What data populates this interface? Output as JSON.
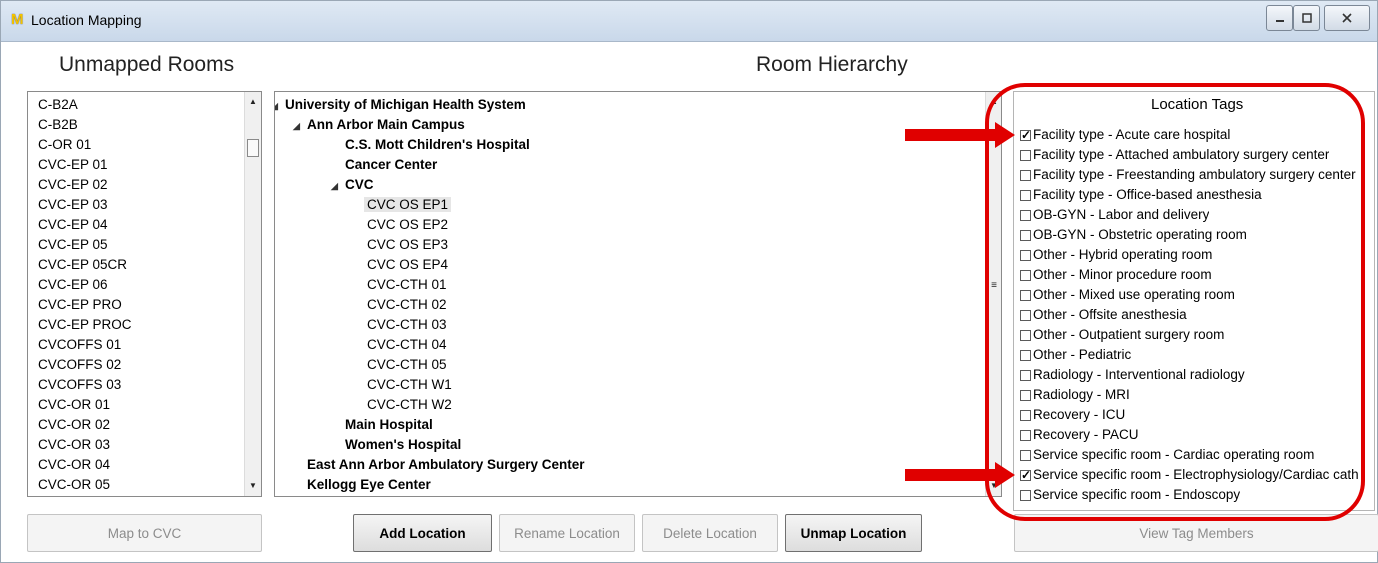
{
  "window": {
    "title": "Location Mapping",
    "app_icon_glyph": "M",
    "controls": [
      "minimize-icon",
      "maximize-icon",
      "close-icon"
    ]
  },
  "unmapped": {
    "title": "Unmapped Rooms",
    "rooms": [
      "C-B2A",
      "C-B2B",
      "C-OR 01",
      "CVC-EP 01",
      "CVC-EP 02",
      "CVC-EP 03",
      "CVC-EP 04",
      "CVC-EP 05",
      "CVC-EP 05CR",
      "CVC-EP 06",
      "CVC-EP PRO",
      "CVC-EP PROC",
      "CVCOFFS 01",
      "CVCOFFS 02",
      "CVCOFFS 03",
      "CVC-OR 01",
      "CVC-OR 02",
      "CVC-OR 03",
      "CVC-OR 04",
      "CVC-OR 05"
    ],
    "map_button": "Map to CVC"
  },
  "hierarchy": {
    "title": "Room Hierarchy",
    "nodes": [
      {
        "label": "University of Michigan Health System",
        "level": 0,
        "expanded": true,
        "bold": true
      },
      {
        "label": "Ann Arbor Main Campus",
        "level": 1,
        "expanded": true,
        "bold": true
      },
      {
        "label": "C.S. Mott Children's Hospital",
        "level": 2,
        "bold": true
      },
      {
        "label": "Cancer Center",
        "level": 2,
        "bold": true
      },
      {
        "label": "CVC",
        "level": 2,
        "expanded": true,
        "bold": true
      },
      {
        "label": "CVC OS EP1",
        "level": 3,
        "bold": false,
        "selected": true
      },
      {
        "label": "CVC OS EP2",
        "level": 3,
        "bold": false
      },
      {
        "label": "CVC OS EP3",
        "level": 3,
        "bold": false
      },
      {
        "label": "CVC OS EP4",
        "level": 3,
        "bold": false
      },
      {
        "label": "CVC-CTH 01",
        "level": 3,
        "bold": false
      },
      {
        "label": "CVC-CTH 02",
        "level": 3,
        "bold": false
      },
      {
        "label": "CVC-CTH 03",
        "level": 3,
        "bold": false
      },
      {
        "label": "CVC-CTH 04",
        "level": 3,
        "bold": false
      },
      {
        "label": "CVC-CTH 05",
        "level": 3,
        "bold": false
      },
      {
        "label": "CVC-CTH W1",
        "level": 3,
        "bold": false
      },
      {
        "label": "CVC-CTH W2",
        "level": 3,
        "bold": false
      },
      {
        "label": "Main Hospital",
        "level": 2,
        "bold": true
      },
      {
        "label": "Women's Hospital",
        "level": 2,
        "bold": true
      },
      {
        "label": "East Ann Arbor Ambulatory Surgery Center",
        "level": 1,
        "bold": true
      },
      {
        "label": "Kellogg Eye Center",
        "level": 1,
        "bold": true
      }
    ],
    "buttons": {
      "add": "Add Location",
      "rename": "Rename Location",
      "delete": "Delete Location",
      "unmap": "Unmap Location"
    }
  },
  "tags": {
    "title": "Location Tags",
    "check_glyph": "✓",
    "items": [
      {
        "label": "Facility type - Acute care hospital",
        "checked": true
      },
      {
        "label": "Facility type - Attached ambulatory surgery center",
        "checked": false
      },
      {
        "label": "Facility type - Freestanding ambulatory surgery center",
        "checked": false
      },
      {
        "label": "Facility type - Office-based anesthesia",
        "checked": false
      },
      {
        "label": "OB-GYN - Labor and delivery",
        "checked": false
      },
      {
        "label": "OB-GYN - Obstetric operating room",
        "checked": false
      },
      {
        "label": "Other - Hybrid operating room",
        "checked": false
      },
      {
        "label": "Other - Minor procedure room",
        "checked": false
      },
      {
        "label": "Other - Mixed use operating room",
        "checked": false
      },
      {
        "label": "Other - Offsite anesthesia",
        "checked": false
      },
      {
        "label": "Other - Outpatient surgery room",
        "checked": false
      },
      {
        "label": "Other - Pediatric",
        "checked": false
      },
      {
        "label": "Radiology - Interventional radiology",
        "checked": false
      },
      {
        "label": "Radiology - MRI",
        "checked": false
      },
      {
        "label": "Recovery - ICU",
        "checked": false
      },
      {
        "label": "Recovery - PACU",
        "checked": false
      },
      {
        "label": "Service specific room - Cardiac operating room",
        "checked": false
      },
      {
        "label": "Service specific room - Electrophysiology/Cardiac cath",
        "checked": true
      },
      {
        "label": "Service specific room - Endoscopy",
        "checked": false
      }
    ],
    "view_button": "View Tag Members"
  },
  "colors": {
    "annotation": "#e00000"
  }
}
